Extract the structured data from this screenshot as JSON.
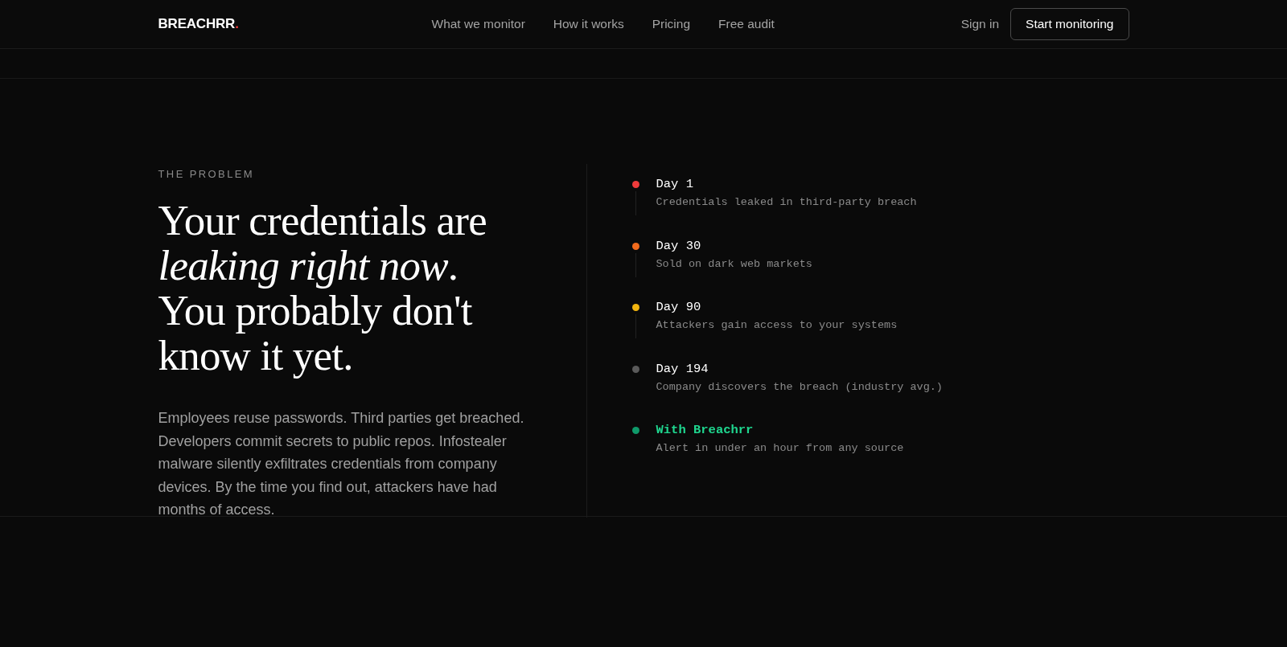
{
  "nav": {
    "logo": {
      "text": "BREACHRR",
      "mark": "."
    },
    "links": [
      {
        "label": "What we monitor"
      },
      {
        "label": "How it works"
      },
      {
        "label": "Pricing"
      },
      {
        "label": "Free audit"
      }
    ],
    "sign_in": "Sign in",
    "cta": "Start monitoring"
  },
  "problem": {
    "eyebrow": "THE PROBLEM",
    "headline": [
      "Your credentials are",
      "*leaking right now*.",
      "You probably don't",
      "know it yet."
    ],
    "body": "Employees reuse passwords. Third parties get breached. Developers commit secrets to public repos. Infostealer malware silently exfiltrates credentials from company devices. By the time you find out, attackers have had months of access.",
    "timeline": [
      {
        "kind": "step",
        "title": "Day 1",
        "text": "Credentials leaked in third-party breach",
        "color": "#ef3b3b"
      },
      {
        "kind": "step",
        "title": "Day 30",
        "text": "Sold on dark web markets",
        "color": "#f26b1d"
      },
      {
        "kind": "step",
        "title": "Day 90",
        "text": "Attackers gain access to your systems",
        "color": "#f2b50f"
      },
      {
        "kind": "step",
        "title": "Day 194",
        "text": "Company discovers the breach (industry avg.)",
        "color": "#5a5a5a"
      },
      {
        "kind": "outcome",
        "title": "With Breachrr",
        "text": "Alert in under an hour from any source",
        "color": "#0f9a6a"
      }
    ]
  }
}
